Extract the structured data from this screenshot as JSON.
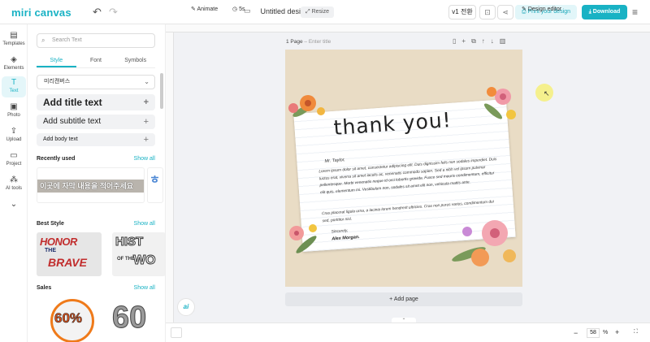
{
  "header": {
    "logo": "miri canvas",
    "undo_icon": "undo-icon",
    "redo_icon": "redo-icon",
    "doc_title": "Untitled design",
    "resize_label": "Resize",
    "version_label": "v1 전환",
    "print_label": "Print your design",
    "download_label": "Download"
  },
  "rail": {
    "items": [
      {
        "label": "Templates",
        "icon": "templates-icon"
      },
      {
        "label": "Elements",
        "icon": "elements-icon"
      },
      {
        "label": "Text",
        "icon": "text-icon"
      },
      {
        "label": "Photo",
        "icon": "photo-icon"
      },
      {
        "label": "Upload",
        "icon": "upload-icon"
      },
      {
        "label": "Project",
        "icon": "project-icon"
      },
      {
        "label": "AI tools",
        "icon": "ai-tools-icon"
      }
    ]
  },
  "panel": {
    "search_placeholder": "Search Text",
    "tabs": [
      "Style",
      "Font",
      "Symbols"
    ],
    "font_name": "미리캔버스",
    "add_title": "Add title text",
    "add_subtitle": "Add subtitle text",
    "add_body": "Add body text",
    "recently_used": "Recently used",
    "best_style": "Best Style",
    "sales": "Sales",
    "show_all": "Show all",
    "recent_sample": "이곳에 자막 내용을 적어주세요",
    "best_1_top": "HONOR",
    "best_1_mid": "THE",
    "best_1_bot": "BRAVE",
    "best_2_top": "HIST",
    "best_2_mid": "OF THE",
    "best_2_bot": "WO",
    "sales_1": "60%",
    "sales_2": "60"
  },
  "canvas": {
    "page_label": "1 Page",
    "page_title_placeholder": "Enter title",
    "card_heading": "thank you!",
    "salutation": "Mr. Taylor,",
    "body_1": "Lorem ipsum dolor sit amet, consectetur adipiscing elit. Duis dignissim felis non sodales imperdiet. Duis luctus erat, viverra sit amet iaculis ac, venenatis commodo sapien. Sed a nibh vel ipsum pulvinar pellentesque. Morbi venenatis neque id orci lobortis gravida. Fusce sed mauris condimentum, efficitur elit quis, elementum mi. Vestibulum non, sodales sit amet elit non, vehicula mattis ante.",
    "body_2": "Cras placerat ligula urna, a lacinia lorem hendrerit ultricies. Cras non purus varius, condimentum dui sed, porttitor nisl.",
    "closing": "Sincerely,",
    "signature": "Alex Morgan.",
    "add_page": "Add page"
  },
  "bottom": {
    "animate": "Animate",
    "duration": "5s",
    "design_editor": "Design editor",
    "zoom": "58",
    "zoom_unit": "%"
  },
  "colors": {
    "brand": "#19b2c4",
    "card_bg": "#e9dcc5"
  }
}
